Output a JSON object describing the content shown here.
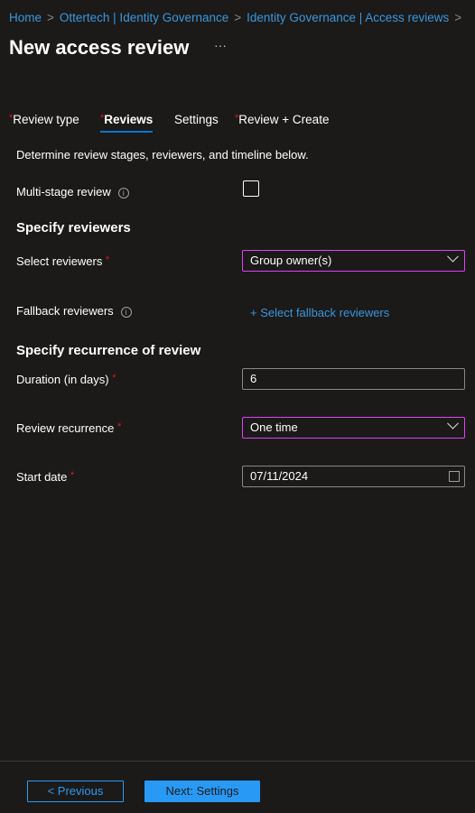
{
  "breadcrumb": [
    "Home",
    "Ottertech | Identity Governance",
    "Identity Governance | Access reviews"
  ],
  "title": "New access review",
  "more": "···",
  "tabs": [
    {
      "label": "Review type",
      "required": true
    },
    {
      "label": "Reviews",
      "required": true,
      "active": true
    },
    {
      "label": "Settings",
      "required": false
    },
    {
      "label": "Review + Create",
      "required": true
    }
  ],
  "req": "*",
  "intro": "Determine review stages, reviewers, and timeline below.",
  "multistage": {
    "label": "Multi-stage review",
    "checked": false
  },
  "specify_reviewers": "Specify reviewers",
  "select_reviewers": {
    "label": "Select reviewers",
    "value": "Group owner(s)"
  },
  "fallback": {
    "label": "Fallback reviewers",
    "link": "+ Select fallback reviewers"
  },
  "specify_recurrence": "Specify recurrence of review",
  "duration": {
    "label": "Duration (in days)",
    "value": "6"
  },
  "recurrence": {
    "label": "Review recurrence",
    "value": "One time"
  },
  "start_date": {
    "label": "Start date",
    "value": "07/11/2024"
  },
  "info": "i",
  "footer": {
    "previous": "< Previous",
    "next": "Next: Settings"
  }
}
